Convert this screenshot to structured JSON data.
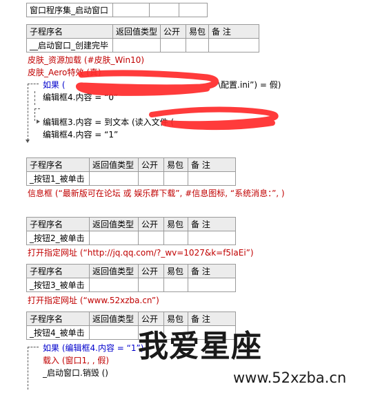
{
  "top_table": {
    "name": "窗口程序集_启动窗口",
    "cells": [
      "",
      "",
      ""
    ]
  },
  "headers": [
    "子程序名",
    "返回值类型",
    "公开",
    "易包",
    "备 注"
  ],
  "sub1": {
    "name": "__启动窗口_创建完毕",
    "code": [
      "皮肤_资源加载 (#皮肤_Win10)",
      "皮肤_Aero特效 (真)",
      "如果 (",
      "\\配置.ini”) = 假)",
      "编辑框4.内容 = “0”",
      "编辑框3.内容 = 到文本 (读入文件 (",
      "编辑框4.内容 = “1”"
    ]
  },
  "sub2": {
    "name": "_按钮1_被单击",
    "code": "信息框 (“最新版可在论坛 或 娱乐群下载”, #信息图标, “系统消息：”, )"
  },
  "sub3": {
    "name": "_按钮2_被单击",
    "code": "打开指定网址 (“http://jq.qq.com/?_wv=1027&k=f5laEi”)"
  },
  "sub4": {
    "name": "_按钮3_被单击",
    "code": "打开指定网址 (“www.52xzba.cn”)"
  },
  "sub5": {
    "name": "_按钮4_被单击",
    "code": [
      "如果 (编辑框4.内容 = “1”)",
      "载入 (窗口1, , 假)",
      "_启动窗口.销毁 ()"
    ]
  },
  "watermark": {
    "title": "我爱星座",
    "url": "www.52xzba.cn"
  },
  "colors": {
    "keyword": "#c00000",
    "flow": "#0000cc",
    "scribble": "#ff2a2a"
  }
}
